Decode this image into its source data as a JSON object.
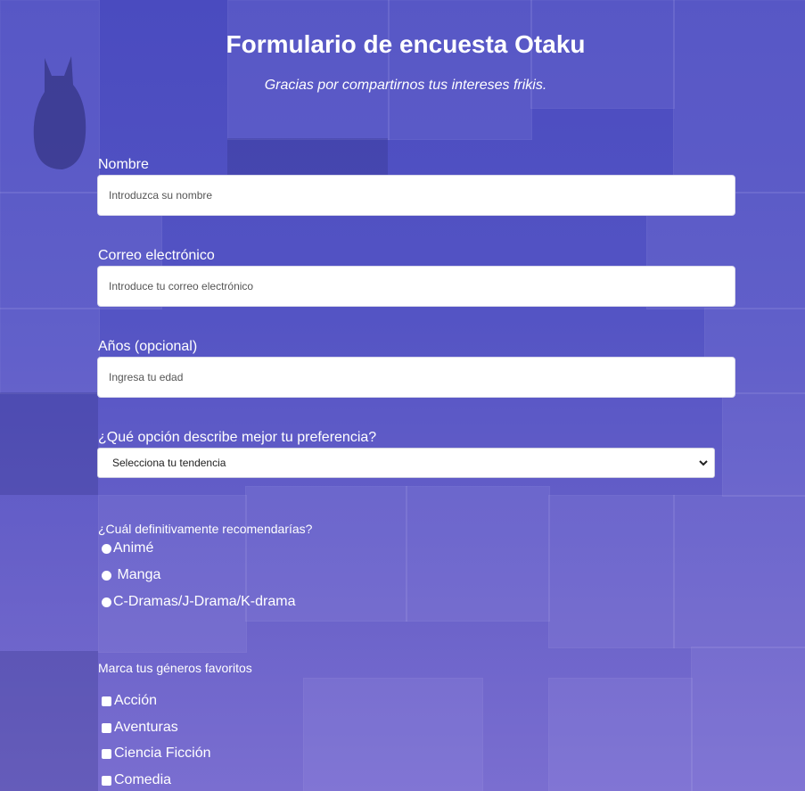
{
  "form": {
    "title": "Formulario de encuesta Otaku",
    "subtitle": "Gracias por compartirnos tus intereses frikis."
  },
  "fields": {
    "name": {
      "label": "Nombre",
      "placeholder": "Introduzca su nombre"
    },
    "email": {
      "label": "Correo electrónico",
      "placeholder": "Introduce tu correo electrónico"
    },
    "age": {
      "label": "Años (opcional)",
      "placeholder": "Ingresa tu edad"
    },
    "preference": {
      "label": "¿Qué opción describe mejor tu preferencia?",
      "selected": "Selecciona tu tendencia"
    }
  },
  "recommend": {
    "label": "¿Cuál definitivamente recomendarías?",
    "options": [
      "Animé",
      " Manga",
      "C-Dramas/J-Drama/K-drama"
    ]
  },
  "genres": {
    "label": "Marca tus géneros favoritos",
    "options": [
      "Acción",
      "Aventuras",
      "Ciencia Ficción",
      "Comedia"
    ]
  },
  "colors": {
    "background": "#5454c4",
    "text": "#ffffff",
    "input_bg": "#ffffff"
  },
  "icons": {
    "select_arrow": "chevron-down-icon",
    "background_art": "cat-silhouette"
  }
}
